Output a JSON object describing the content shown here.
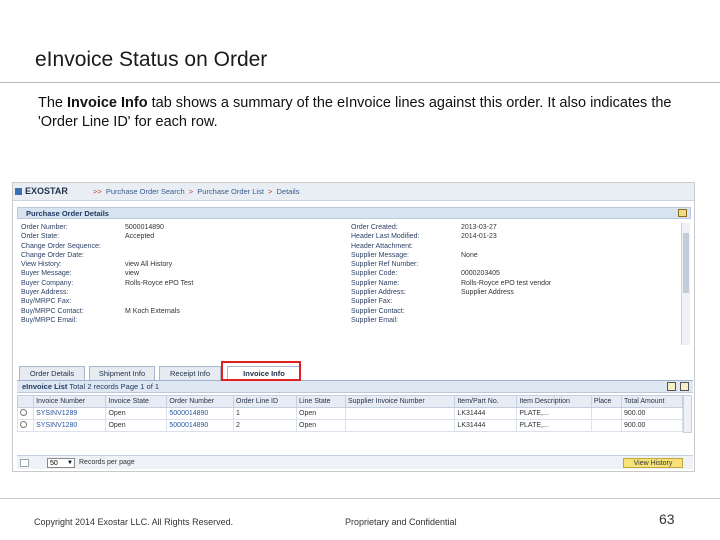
{
  "slide": {
    "title": "eInvoice Status on Order",
    "intro_prefix": "The ",
    "intro_bold": "Invoice Info",
    "intro_suffix": " tab shows a summary of the eInvoice lines against this order.  It also indicates the 'Order Line ID' for each row."
  },
  "app": {
    "brand": "EXOSTAR",
    "breadcrumb": [
      "Purchase Order Search",
      "Purchase Order List",
      "Details"
    ],
    "panel_title": "Purchase Order Details",
    "details_left": [
      {
        "label": "Order Number:",
        "value": "5000014890"
      },
      {
        "label": "Order State:",
        "value": "Accepted"
      },
      {
        "label": "Change Order Sequence:",
        "value": ""
      },
      {
        "label": "Change Order Date:",
        "value": ""
      },
      {
        "label": "View History:",
        "value": "view All History"
      },
      {
        "label": "Buyer Message:",
        "value": "view"
      },
      {
        "label": "Buyer Company:",
        "value": "Rolls-Royce ePO Test"
      },
      {
        "label": "Buyer Address:",
        "value": ""
      },
      {
        "label": "Buy/MRPC Fax:",
        "value": ""
      },
      {
        "label": "Buy/MRPC Contact:",
        "value": "M Koch Externals"
      },
      {
        "label": "Buy/MRPC Email:",
        "value": ""
      }
    ],
    "details_right": [
      {
        "label": "Order Created:",
        "value": "2013-03-27"
      },
      {
        "label": "Header Last Modified:",
        "value": "2014-01-23"
      },
      {
        "label": "Header Attachment:",
        "value": ""
      },
      {
        "label": "Supplier Message:",
        "value": "None"
      },
      {
        "label": "Supplier Ref Number:",
        "value": ""
      },
      {
        "label": "Supplier Code:",
        "value": "0000203405"
      },
      {
        "label": "Supplier Name:",
        "value": "Rolls-Royce ePO test vendor"
      },
      {
        "label": "Supplier Address:",
        "value": "Supplier Address"
      },
      {
        "label": "Supplier Fax:",
        "value": ""
      },
      {
        "label": "Supplier Contact:",
        "value": ""
      },
      {
        "label": "Supplier Email:",
        "value": ""
      }
    ],
    "tabs": [
      "Order Details",
      "Shipment Info",
      "Receipt Info",
      "Invoice Info"
    ],
    "list_title": "eInvoice List",
    "list_summary": "Total 2 records Page 1 of 1",
    "columns": [
      "",
      "Invoice Number",
      "Invoice State",
      "Order Number",
      "Order Line ID",
      "Line State",
      "Supplier Invoice Number",
      "Item/Part No.",
      "Item Description",
      "Place",
      "Total Amount"
    ],
    "rows": [
      [
        "",
        "SYSINV1289",
        "Open",
        "5000014890",
        "1",
        "Open",
        "",
        "LK31444",
        "PLATE,...",
        "",
        "900.00"
      ],
      [
        "",
        "SYSINV1280",
        "Open",
        "5000014890",
        "2",
        "Open",
        "",
        "LK31444",
        "PLATE,...",
        "",
        "900.00"
      ]
    ],
    "page_size": "50",
    "records_per_page": "Records per page",
    "view_history_button": "View History"
  },
  "footer": {
    "copyright": "Copyright 2014 Exostar LLC. All Rights Reserved.",
    "confidential": "Proprietary and Confidential",
    "page_number": "63"
  },
  "colors": {
    "highlight": "#e02020",
    "header_blue": "#d8e3f1",
    "button_yellow": "#f7e37a"
  }
}
